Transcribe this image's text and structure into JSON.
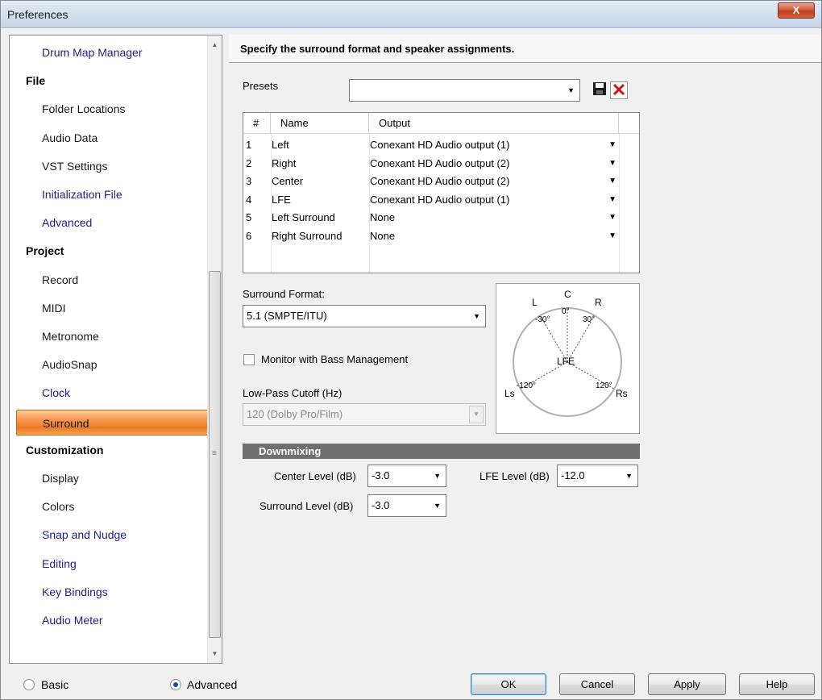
{
  "window": {
    "title": "Preferences",
    "close_glyph": "X"
  },
  "sidebar": {
    "items": [
      {
        "label": "Drum Map Manager",
        "kind": "child-link"
      },
      {
        "label": "File",
        "kind": "group"
      },
      {
        "label": "Folder Locations",
        "kind": "child"
      },
      {
        "label": "Audio Data",
        "kind": "child"
      },
      {
        "label": "VST Settings",
        "kind": "child"
      },
      {
        "label": "Initialization File",
        "kind": "child-link"
      },
      {
        "label": "Advanced",
        "kind": "child-link"
      },
      {
        "label": "Project",
        "kind": "group"
      },
      {
        "label": "Record",
        "kind": "child"
      },
      {
        "label": "MIDI",
        "kind": "child"
      },
      {
        "label": "Metronome",
        "kind": "child"
      },
      {
        "label": "AudioSnap",
        "kind": "child"
      },
      {
        "label": "Clock",
        "kind": "child-link"
      },
      {
        "label": "Surround",
        "kind": "selected"
      },
      {
        "label": "Customization",
        "kind": "group"
      },
      {
        "label": "Display",
        "kind": "child"
      },
      {
        "label": "Colors",
        "kind": "child"
      },
      {
        "label": "Snap and Nudge",
        "kind": "child-link"
      },
      {
        "label": "Editing",
        "kind": "child-link"
      },
      {
        "label": "Key Bindings",
        "kind": "child-link"
      },
      {
        "label": "Audio Meter",
        "kind": "child-link"
      }
    ]
  },
  "header": {
    "description": "Specify the surround format and speaker assignments."
  },
  "presets": {
    "label": "Presets",
    "value": ""
  },
  "table": {
    "headers": [
      "#",
      "Name",
      "Output"
    ],
    "rows": [
      [
        "1",
        "Left",
        "Conexant HD Audio output (1)"
      ],
      [
        "2",
        "Right",
        "Conexant HD Audio output (2)"
      ],
      [
        "3",
        "Center",
        "Conexant HD Audio output (2)"
      ],
      [
        "4",
        "LFE",
        "Conexant HD Audio output (1)"
      ],
      [
        "5",
        "Left Surround",
        "None"
      ],
      [
        "6",
        "Right Surround",
        "None"
      ]
    ]
  },
  "surround_format": {
    "label": "Surround Format:",
    "value": "5.1 (SMPTE/ITU)"
  },
  "monitor_bass": {
    "label": "Monitor with Bass Management",
    "checked": false
  },
  "low_pass": {
    "label": "Low-Pass Cutoff (Hz)",
    "value": "120 (Dolby Pro/Film)"
  },
  "diagram": {
    "C": "C",
    "L": "L",
    "R": "R",
    "LFE": "LFE",
    "Ls": "Ls",
    "Rs": "Rs",
    "angle_c": "0°",
    "angle_l": "-30°",
    "angle_r": "30°",
    "angle_ls": "-120°",
    "angle_rs": "120°"
  },
  "downmixing": {
    "title": "Downmixing",
    "center_label": "Center Level (dB)",
    "center_value": "-3.0",
    "surround_label": "Surround Level (dB)",
    "surround_value": "-3.0",
    "lfe_label": "LFE Level (dB)",
    "lfe_value": "-12.0"
  },
  "footer": {
    "basic_label": "Basic",
    "advanced_label": "Advanced",
    "selected_mode": "Advanced",
    "ok": "OK",
    "cancel": "Cancel",
    "apply": "Apply",
    "help": "Help"
  },
  "colors": {
    "selection": "#f28a30",
    "section_bar": "#6f6f6f",
    "close_red": "#c7432a",
    "link": "#1f1f8f"
  }
}
